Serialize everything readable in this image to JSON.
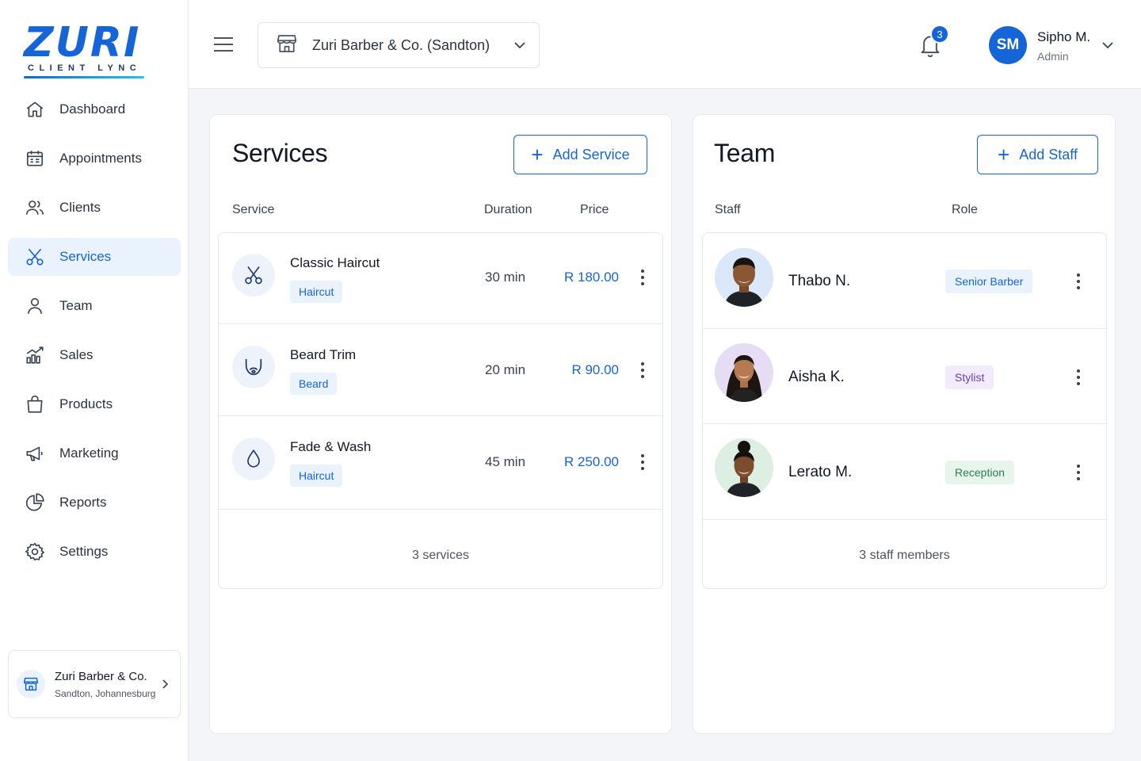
{
  "brand": {
    "name": "ZURI",
    "tagline": "CLIENT LYNC",
    "accent": "#1565d8"
  },
  "sidebar": {
    "items": [
      {
        "label": "Dashboard",
        "icon": "home-icon"
      },
      {
        "label": "Appointments",
        "icon": "calendar-icon"
      },
      {
        "label": "Clients",
        "icon": "users-icon"
      },
      {
        "label": "Services",
        "icon": "scissors-icon",
        "active": true
      },
      {
        "label": "Team",
        "icon": "user-icon"
      },
      {
        "label": "Sales",
        "icon": "chart-icon"
      },
      {
        "label": "Products",
        "icon": "bag-icon"
      },
      {
        "label": "Marketing",
        "icon": "megaphone-icon"
      },
      {
        "label": "Reports",
        "icon": "pie-icon"
      },
      {
        "label": "Settings",
        "icon": "gear-icon"
      }
    ],
    "business": {
      "name": "Zuri Barber & Co.",
      "location": "Sandton, Johannesburg"
    }
  },
  "header": {
    "location": "Zuri Barber & Co. (Sandton)",
    "notifications": "3",
    "user": {
      "initials": "SM",
      "name": "Sipho M.",
      "role": "Admin"
    }
  },
  "services": {
    "title": "Services",
    "add_label": "Add Service",
    "columns": {
      "service": "Service",
      "duration": "Duration",
      "price": "Price"
    },
    "rows": [
      {
        "name": "Classic Haircut",
        "tag": "Haircut",
        "duration": "30 min",
        "price": "R 180.00",
        "icon": "scissors-icon"
      },
      {
        "name": "Beard Trim",
        "tag": "Beard",
        "duration": "20 min",
        "price": "R 90.00",
        "icon": "beard-icon"
      },
      {
        "name": "Fade & Wash",
        "tag": "Haircut",
        "duration": "45 min",
        "price": "R 250.00",
        "icon": "water-drop-icon"
      }
    ],
    "footer": "3 services"
  },
  "team": {
    "title": "Team",
    "add_label": "Add Staff",
    "columns": {
      "staff": "Staff",
      "role": "Role"
    },
    "rows": [
      {
        "name": "Thabo N.",
        "role": "Senior Barber",
        "role_color": "#1565d8",
        "role_bg": "#eaf2fe"
      },
      {
        "name": "Aisha K.",
        "role": "Stylist",
        "role_color": "#6b3fb0",
        "role_bg": "#f1ebfb"
      },
      {
        "name": "Lerato M.",
        "role": "Reception",
        "role_color": "#2e7d4f",
        "role_bg": "#e8f5ec"
      }
    ],
    "footer": "3 staff members"
  }
}
